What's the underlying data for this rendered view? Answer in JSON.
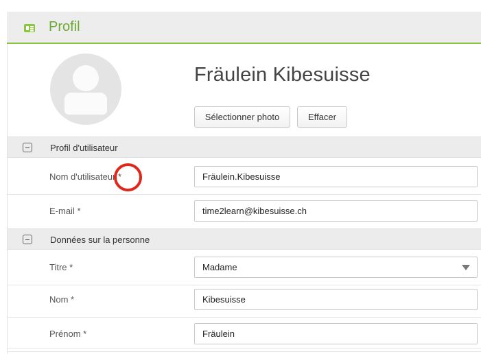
{
  "header": {
    "title": "Profil",
    "icon": "id-card-icon",
    "accent_color": "#8cc63f"
  },
  "profile": {
    "display_name": "Fräulein Kibesuisse",
    "avatar_icon": "user-placeholder-icon",
    "select_photo_label": "Sélectionner photo",
    "clear_label": "Effacer"
  },
  "sections": [
    {
      "title": "Profil d'utilisateur",
      "toggle_icon": "collapse-minus-icon",
      "fields": [
        {
          "label": "Nom d'utilisateur *",
          "value": "Fräulein.Kibesuisse"
        },
        {
          "label": "E-mail *",
          "value": "time2learn@kibesuisse.ch"
        }
      ]
    },
    {
      "title": "Données sur la personne",
      "toggle_icon": "collapse-minus-icon",
      "fields": [
        {
          "label": "Titre *",
          "value": "Madame",
          "type": "select"
        },
        {
          "label": "Nom *",
          "value": "Kibesuisse"
        },
        {
          "label": "Prénom *",
          "value": "Fräulein"
        }
      ]
    }
  ],
  "annotation": {
    "color": "#e0271b"
  }
}
